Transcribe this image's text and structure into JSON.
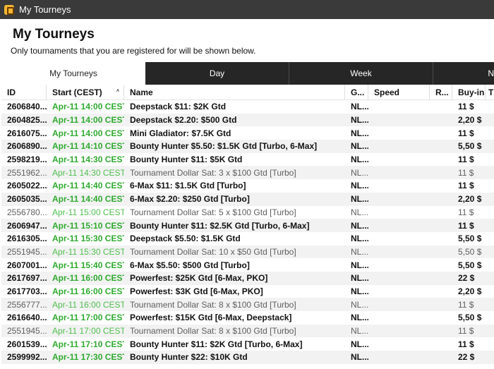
{
  "window": {
    "title": "My Tourneys"
  },
  "page": {
    "heading": "My Tourneys",
    "subheading": "Only tournaments that you are registered for will be shown below."
  },
  "tabs": [
    {
      "label": "My Tourneys"
    },
    {
      "label": "Day"
    },
    {
      "label": "Week"
    },
    {
      "label": "N"
    }
  ],
  "table": {
    "columns": [
      "ID",
      "Start (CEST)",
      "Name",
      "G...",
      "Speed",
      "R...",
      "Buy-in",
      "T"
    ],
    "sort_indicator": "˄",
    "rows": [
      {
        "id": "2606840...",
        "start": "Apr-11 14:00 CEST",
        "name": "Deepstack $11: $2K Gtd",
        "game": "NL...",
        "speed": "",
        "r": "",
        "buyin": "11 $",
        "bold": true
      },
      {
        "id": "2604825...",
        "start": "Apr-11 14:00 CEST",
        "name": "Deepstack $2.20: $500 Gtd",
        "game": "NL...",
        "speed": "",
        "r": "",
        "buyin": "2,20 $",
        "bold": true
      },
      {
        "id": "2616075...",
        "start": "Apr-11 14:00 CEST",
        "name": "Mini Gladiator: $7.5K Gtd",
        "game": "NL...",
        "speed": "",
        "r": "",
        "buyin": "11 $",
        "bold": true
      },
      {
        "id": "2606890...",
        "start": "Apr-11 14:10 CEST",
        "name": "Bounty Hunter $5.50: $1.5K Gtd [Turbo, 6-Max]",
        "game": "NL...",
        "speed": "",
        "r": "",
        "buyin": "5,50 $",
        "bold": true
      },
      {
        "id": "2598219...",
        "start": "Apr-11 14:30 CEST",
        "name": "Bounty Hunter $11: $5K Gtd",
        "game": "NL...",
        "speed": "",
        "r": "",
        "buyin": "11 $",
        "bold": true
      },
      {
        "id": "2551962...",
        "start": "Apr-11 14:30 CEST",
        "name": "Tournament Dollar Sat: 3 x $100 Gtd [Turbo]",
        "game": "NL...",
        "speed": "",
        "r": "",
        "buyin": "11 $",
        "bold": false
      },
      {
        "id": "2605022...",
        "start": "Apr-11 14:40 CEST",
        "name": "6-Max $11: $1.5K Gtd [Turbo]",
        "game": "NL...",
        "speed": "",
        "r": "",
        "buyin": "11 $",
        "bold": true
      },
      {
        "id": "2605035...",
        "start": "Apr-11 14:40 CEST",
        "name": "6-Max $2.20: $250 Gtd [Turbo]",
        "game": "NL...",
        "speed": "",
        "r": "",
        "buyin": "2,20 $",
        "bold": true
      },
      {
        "id": "2556780...",
        "start": "Apr-11 15:00 CEST",
        "name": "Tournament Dollar Sat: 5 x $100 Gtd [Turbo]",
        "game": "NL...",
        "speed": "",
        "r": "",
        "buyin": "11 $",
        "bold": false
      },
      {
        "id": "2606947...",
        "start": "Apr-11 15:10 CEST",
        "name": "Bounty Hunter $11: $2.5K Gtd [Turbo, 6-Max]",
        "game": "NL...",
        "speed": "",
        "r": "",
        "buyin": "11 $",
        "bold": true
      },
      {
        "id": "2616305...",
        "start": "Apr-11 15:30 CEST",
        "name": "Deepstack $5.50: $1.5K Gtd",
        "game": "NL...",
        "speed": "",
        "r": "",
        "buyin": "5,50 $",
        "bold": true
      },
      {
        "id": "2551945...",
        "start": "Apr-11 15:30 CEST",
        "name": "Tournament Dollar Sat: 10 x $50 Gtd [Turbo]",
        "game": "NL...",
        "speed": "",
        "r": "",
        "buyin": "5,50 $",
        "bold": false
      },
      {
        "id": "2607001...",
        "start": "Apr-11 15:40 CEST",
        "name": "6-Max $5.50: $500 Gtd [Turbo]",
        "game": "NL...",
        "speed": "",
        "r": "",
        "buyin": "5,50 $",
        "bold": true
      },
      {
        "id": "2617697...",
        "start": "Apr-11 16:00 CEST",
        "name": "Powerfest: $25K Gtd [6-Max, PKO]",
        "game": "NL...",
        "speed": "",
        "r": "",
        "buyin": "22 $",
        "bold": true
      },
      {
        "id": "2617703...",
        "start": "Apr-11 16:00 CEST",
        "name": "Powerfest: $3K Gtd [6-Max, PKO]",
        "game": "NL...",
        "speed": "",
        "r": "",
        "buyin": "2,20 $",
        "bold": true
      },
      {
        "id": "2556777...",
        "start": "Apr-11 16:00 CEST",
        "name": "Tournament Dollar Sat: 8 x $100 Gtd [Turbo]",
        "game": "NL...",
        "speed": "",
        "r": "",
        "buyin": "11 $",
        "bold": false
      },
      {
        "id": "2616640...",
        "start": "Apr-11 17:00 CEST",
        "name": "Powerfest: $15K Gtd [6-Max, Deepstack]",
        "game": "NL...",
        "speed": "",
        "r": "",
        "buyin": "5,50 $",
        "bold": true
      },
      {
        "id": "2551945...",
        "start": "Apr-11 17:00 CEST",
        "name": "Tournament Dollar Sat: 8 x $100 Gtd [Turbo]",
        "game": "NL...",
        "speed": "",
        "r": "",
        "buyin": "11 $",
        "bold": false
      },
      {
        "id": "2601539...",
        "start": "Apr-11 17:10 CEST",
        "name": "Bounty Hunter $11: $2K Gtd [Turbo, 6-Max]",
        "game": "NL...",
        "speed": "",
        "r": "",
        "buyin": "11 $",
        "bold": true
      },
      {
        "id": "2599992...",
        "start": "Apr-11 17:30 CEST",
        "name": "Bounty Hunter $22: $10K Gtd",
        "game": "NL...",
        "speed": "",
        "r": "",
        "buyin": "22 $",
        "bold": true
      }
    ]
  }
}
